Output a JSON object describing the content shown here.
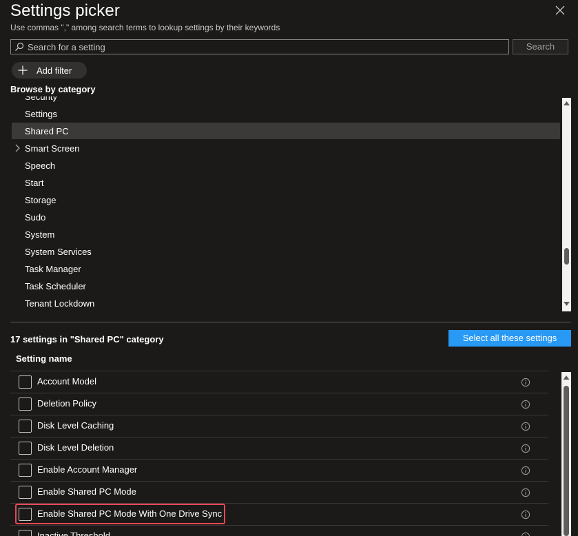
{
  "header": {
    "title": "Settings picker",
    "subtitle": "Use commas \",\" among search terms to lookup settings by their keywords"
  },
  "search": {
    "placeholder": "Search for a setting",
    "value": "",
    "button_label": "Search"
  },
  "filter": {
    "add_label": "Add filter"
  },
  "browse": {
    "heading": "Browse by category",
    "items": [
      {
        "label": "Security",
        "selected": false,
        "expandable": false
      },
      {
        "label": "Settings",
        "selected": false,
        "expandable": false
      },
      {
        "label": "Shared PC",
        "selected": true,
        "expandable": false
      },
      {
        "label": "Smart Screen",
        "selected": false,
        "expandable": true
      },
      {
        "label": "Speech",
        "selected": false,
        "expandable": false
      },
      {
        "label": "Start",
        "selected": false,
        "expandable": false
      },
      {
        "label": "Storage",
        "selected": false,
        "expandable": false
      },
      {
        "label": "Sudo",
        "selected": false,
        "expandable": false
      },
      {
        "label": "System",
        "selected": false,
        "expandable": false
      },
      {
        "label": "System Services",
        "selected": false,
        "expandable": false
      },
      {
        "label": "Task Manager",
        "selected": false,
        "expandable": false
      },
      {
        "label": "Task Scheduler",
        "selected": false,
        "expandable": false
      },
      {
        "label": "Tenant Lockdown",
        "selected": false,
        "expandable": false
      }
    ]
  },
  "settings": {
    "count_label": "17 settings in \"Shared PC\" category",
    "select_all_label": "Select all these settings",
    "column_header": "Setting name",
    "rows": [
      {
        "label": "Account Model",
        "checked": false
      },
      {
        "label": "Deletion Policy",
        "checked": false
      },
      {
        "label": "Disk Level Caching",
        "checked": false
      },
      {
        "label": "Disk Level Deletion",
        "checked": false
      },
      {
        "label": "Enable Account Manager",
        "checked": false
      },
      {
        "label": "Enable Shared PC Mode",
        "checked": false
      },
      {
        "label": "Enable Shared PC Mode With One Drive Sync",
        "checked": false,
        "highlighted": true
      },
      {
        "label": "Inactive Threshold",
        "checked": false
      }
    ]
  },
  "colors": {
    "background": "#1b1a19",
    "accent": "#2899f5",
    "highlight": "#e74856",
    "selected_row": "#3b3a39"
  }
}
